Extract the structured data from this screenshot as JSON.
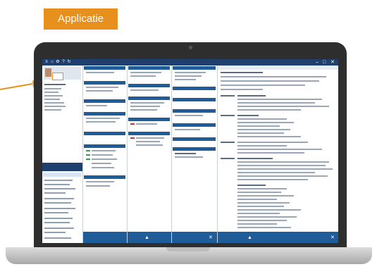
{
  "banner": {
    "title": "Applicatie"
  },
  "colors": {
    "banner": "#e8901e",
    "app_header": "#1f3f6e",
    "section_header": "#1f5c9a",
    "laptop": "#2e2e2e"
  },
  "icons": [
    "home-icon",
    "settings-icon",
    "help-icon",
    "close-icon",
    "minimize-icon",
    "maximize-icon"
  ]
}
